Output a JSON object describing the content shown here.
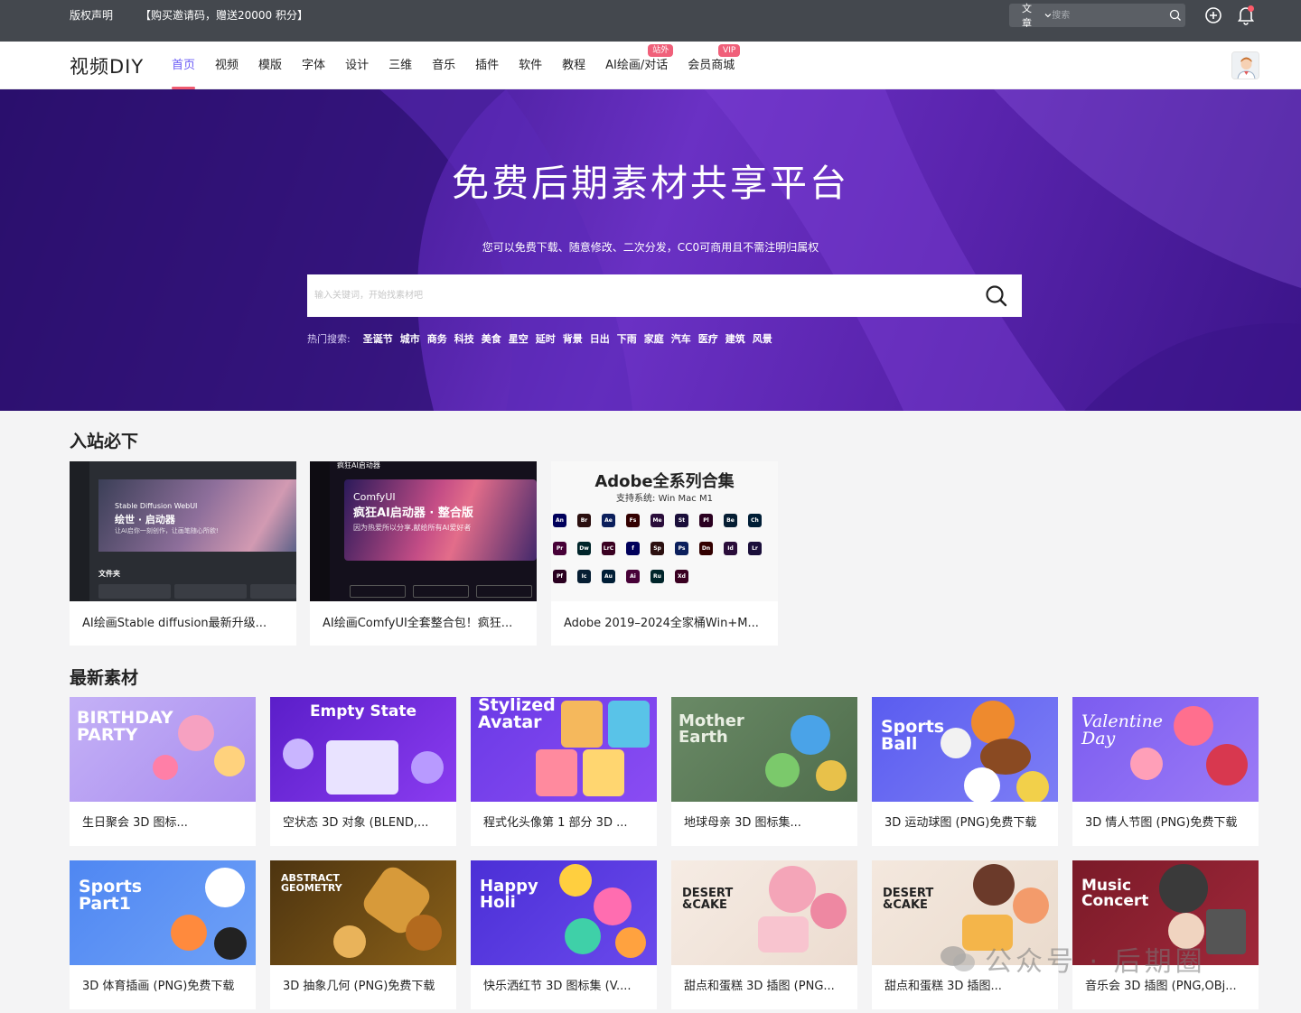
{
  "topbar": {
    "copyright": "版权声明",
    "promo": "【购买邀请码，赠送20000 积分】",
    "search_type": "文章",
    "search_placeholder": "搜索"
  },
  "nav": {
    "logo": "视频DIY",
    "items": [
      {
        "label": "首页",
        "active": true
      },
      {
        "label": "视频"
      },
      {
        "label": "模版"
      },
      {
        "label": "字体"
      },
      {
        "label": "设计"
      },
      {
        "label": "三维"
      },
      {
        "label": "音乐"
      },
      {
        "label": "插件"
      },
      {
        "label": "软件"
      },
      {
        "label": "教程"
      },
      {
        "label": "AI绘画/对话",
        "badge": "站外"
      },
      {
        "label": "会员商城",
        "badge": "VIP"
      }
    ]
  },
  "hero": {
    "title": "免费后期素材共享平台",
    "subtitle": "您可以免费下载、随意修改、二次分发，CC0可商用且不需注明归属权",
    "search_placeholder": "输入关键词，开始找素材吧",
    "hot_label": "热门搜索:",
    "hot_tags": [
      "圣诞节",
      "城市",
      "商务",
      "科技",
      "美食",
      "星空",
      "延时",
      "背景",
      "日出",
      "下雨",
      "家庭",
      "汽车",
      "医疗",
      "建筑",
      "风景"
    ]
  },
  "must_section": {
    "title": "入站必下",
    "cards": [
      {
        "caption": "AI绘画Stable diffusion最新升级...",
        "thumb_title": "Stable Diffusion WebUI",
        "thumb_sub": "绘世 · 启动器",
        "thumb_line": "让AI启你一刻创作，让画笔随心所欲!",
        "thumb_label": "文件夹"
      },
      {
        "caption": "AI绘画ComfyUI全套整合包！疯狂...",
        "thumb_title": "ComfyUI",
        "thumb_sub": "疯狂AI启动器 · 整合版",
        "thumb_line": "因为热爱所以分享,献给所有AI爱好者",
        "thumb_label": "疯狂AI启动器"
      },
      {
        "caption": "Adobe 2019–2024全家桶Win+M...",
        "thumb_title": "Adobe全系列合集",
        "thumb_sub": "支持系统: Win Mac M1",
        "app_icons": [
          "An",
          "Br",
          "Ae",
          "Fs",
          "Me",
          "St",
          "Pl",
          "Be",
          "Ch",
          "Pr",
          "Dw",
          "LrC",
          "f",
          "Sp",
          "Ps",
          "Dn",
          "Id",
          "Lr",
          "Pf",
          "Ic",
          "Au",
          "Ai",
          "Ru",
          "Xd"
        ]
      }
    ]
  },
  "latest_section": {
    "title": "最新素材",
    "cards": [
      {
        "caption": "生日聚会 3D 图标...",
        "thumb_title": "BIRTHDAY PARTY",
        "bg": "#b59bf0"
      },
      {
        "caption": "空状态 3D 对象 (BLEND,...",
        "thumb_title": "Empty State",
        "bg": "#6c2bd9"
      },
      {
        "caption": "程式化头像第 1 部分 3D ...",
        "thumb_title": "Stylized Avatar",
        "bg": "#7c3aed"
      },
      {
        "caption": "地球母亲 3D 图标集...",
        "thumb_title": "Mother Earth",
        "bg": "#5e7d5a"
      },
      {
        "caption": "3D 运动球图 (PNG)免费下载",
        "thumb_title": "Sports Ball",
        "bg": "#6d6cf0"
      },
      {
        "caption": "3D 情人节图 (PNG)免费下载",
        "thumb_title": "Valentine Day",
        "bg": "#7b5cf0"
      },
      {
        "caption": "3D 体育插画 (PNG)免费下载",
        "thumb_title": "Sports Part1",
        "bg": "#5b8df5"
      },
      {
        "caption": "3D 抽象几何 (PNG)免费下载",
        "thumb_title": "ABSTRACT GEOMETRY",
        "bg": "#6b4a12"
      },
      {
        "caption": "快乐洒红节 3D 图标集 (V....",
        "thumb_title": "Happy Holi",
        "bg": "#5b3ce0"
      },
      {
        "caption": "甜点和蛋糕 3D 插图 (PNG...",
        "thumb_title": "DESERT &CAKE",
        "bg": "#f3e6dc"
      },
      {
        "caption": "甜点和蛋糕 3D 插图...",
        "thumb_title": "DESERT &CAKE",
        "bg": "#f1e3d6"
      },
      {
        "caption": "音乐会 3D 插图 (PNG,OBj...",
        "thumb_title": "Music Concert",
        "bg": "#8a1f2e"
      }
    ]
  },
  "watermark": "公众号 · 后期圈",
  "colors": {
    "accent": "#6b5cf6",
    "active_underline": "#ef5a6f",
    "topbar_bg": "#44484e"
  }
}
